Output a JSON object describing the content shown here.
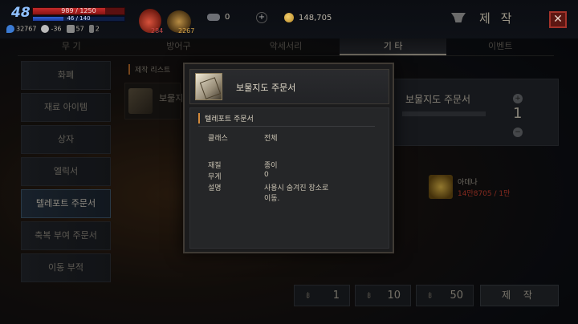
{
  "player": {
    "level": "48",
    "hp_text": "989 / 1250",
    "hp_fraction": 0.79,
    "mp_text": "46 / 140",
    "mp_fraction": 0.33,
    "stats": [
      "32767",
      "-36",
      "57",
      "2"
    ]
  },
  "quick_items": {
    "potion_count": "284",
    "scroll_count": "2267"
  },
  "resources": {
    "stones": "0",
    "gold": "148,705"
  },
  "header": {
    "title": "제 작",
    "close_label": "✕"
  },
  "tabs": [
    {
      "label": "무 기",
      "active": false
    },
    {
      "label": "방어구",
      "active": false
    },
    {
      "label": "악세서리",
      "active": false
    },
    {
      "label": "기 타",
      "active": true
    },
    {
      "label": "이벤트",
      "active": false
    }
  ],
  "categories": [
    {
      "label": "화폐",
      "active": false
    },
    {
      "label": "재료 아이템",
      "active": false
    },
    {
      "label": "상자",
      "active": false
    },
    {
      "label": "엘릭서",
      "active": false
    },
    {
      "label": "텔레포트 주문서",
      "active": true
    },
    {
      "label": "축복 부여 주문서",
      "active": false
    },
    {
      "label": "이동 부적",
      "active": false
    }
  ],
  "craft_list": {
    "title": "제작 리스트",
    "item_label": "보물지"
  },
  "detail": {
    "name": "보물지도 주문서",
    "quantity": "1"
  },
  "material": {
    "name": "아데나",
    "count": "14만8705 / 1만"
  },
  "bottom": {
    "q1": "1",
    "q10": "10",
    "q50": "50",
    "craft_label": "제 작"
  },
  "popup": {
    "item_name": "보물지도 주문서",
    "section": "텔레포트 주문서",
    "rows": [
      {
        "key": "클래스",
        "value": "전체"
      },
      {
        "key": "재질",
        "value": "종이"
      },
      {
        "key": "무게",
        "value": "0"
      },
      {
        "key": "설명",
        "value": "사용시 숨겨진 장소로\n이동."
      }
    ]
  },
  "colors": {
    "accent": "#d38a3a",
    "hp": "#c42a2a",
    "mp": "#2f5fd0",
    "close": "#a2322a"
  }
}
